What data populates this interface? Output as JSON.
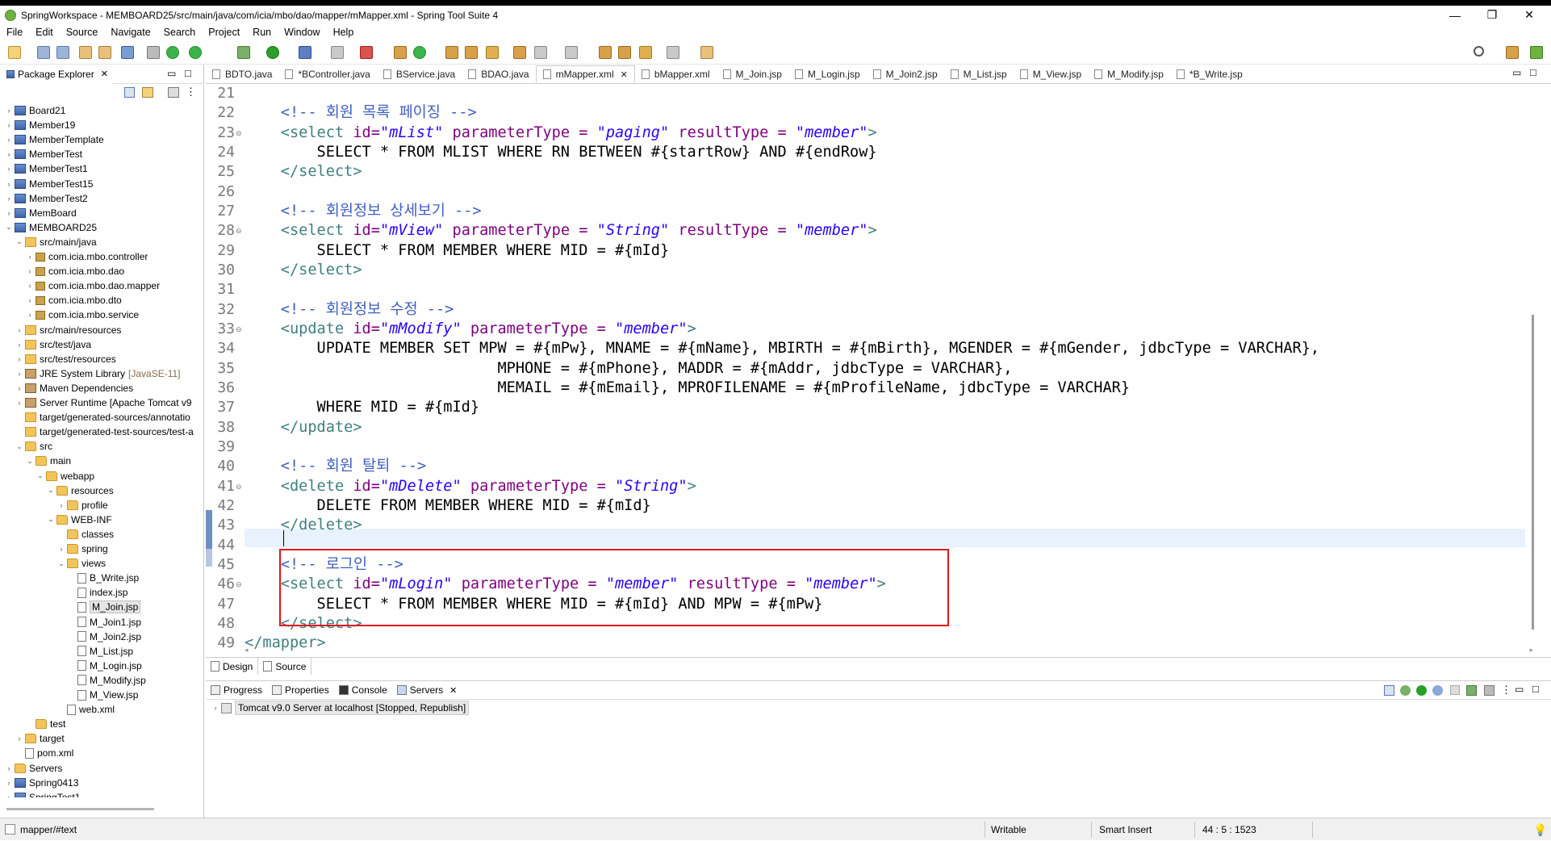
{
  "window": {
    "title": "SpringWorkspace - MEMBOARD25/src/main/java/com/icia/mbo/dao/mapper/mMapper.xml - Spring Tool Suite 4",
    "minimize": "—",
    "maximize": "❐",
    "close": "✕"
  },
  "menu": [
    "File",
    "Edit",
    "Source",
    "Navigate",
    "Search",
    "Project",
    "Run",
    "Window",
    "Help"
  ],
  "package_explorer": {
    "tab_label": "Package Explorer",
    "close": "✕",
    "tree": [
      {
        "label": "Board21",
        "icon": "project-icon",
        "level": 0,
        "twisty": "›"
      },
      {
        "label": "Member19",
        "icon": "project-icon",
        "level": 0,
        "twisty": "›"
      },
      {
        "label": "MemberTemplate",
        "icon": "project-icon",
        "level": 0,
        "twisty": "›"
      },
      {
        "label": "MemberTest",
        "icon": "project-icon",
        "level": 0,
        "twisty": "›"
      },
      {
        "label": "MemberTest1",
        "icon": "project-icon",
        "level": 0,
        "twisty": "›"
      },
      {
        "label": "MemberTest15",
        "icon": "project-icon",
        "level": 0,
        "twisty": "›"
      },
      {
        "label": "MemberTest2",
        "icon": "project-icon",
        "level": 0,
        "twisty": "›"
      },
      {
        "label": "MemBoard",
        "icon": "project-icon",
        "level": 0,
        "twisty": "›"
      },
      {
        "label": "MEMBOARD25",
        "icon": "project-icon",
        "level": 0,
        "twisty": "⌄"
      },
      {
        "label": "src/main/java",
        "icon": "source-folder-icon",
        "level": 1,
        "twisty": "⌄"
      },
      {
        "label": "com.icia.mbo.controller",
        "icon": "package-icon",
        "level": 2,
        "twisty": "›"
      },
      {
        "label": "com.icia.mbo.dao",
        "icon": "package-icon",
        "level": 2,
        "twisty": "›"
      },
      {
        "label": "com.icia.mbo.dao.mapper",
        "icon": "package-icon",
        "level": 2,
        "twisty": "›"
      },
      {
        "label": "com.icia.mbo.dto",
        "icon": "package-icon",
        "level": 2,
        "twisty": "›"
      },
      {
        "label": "com.icia.mbo.service",
        "icon": "package-icon",
        "level": 2,
        "twisty": "›"
      },
      {
        "label": "src/main/resources",
        "icon": "source-folder-icon",
        "level": 1,
        "twisty": "›"
      },
      {
        "label": "src/test/java",
        "icon": "source-folder-icon",
        "level": 1,
        "twisty": "›"
      },
      {
        "label": "src/test/resources",
        "icon": "source-folder-icon",
        "level": 1,
        "twisty": "›"
      },
      {
        "label": "JRE System Library",
        "suffix": "[JavaSE-11]",
        "icon": "library-icon",
        "level": 1,
        "twisty": "›"
      },
      {
        "label": "Maven Dependencies",
        "icon": "library-icon",
        "level": 1,
        "twisty": "›"
      },
      {
        "label": "Server Runtime [Apache Tomcat v9",
        "icon": "library-icon",
        "level": 1,
        "twisty": "›"
      },
      {
        "label": "target/generated-sources/annotatio",
        "icon": "source-folder-icon",
        "level": 1,
        "twisty": ""
      },
      {
        "label": "target/generated-test-sources/test-a",
        "icon": "source-folder-icon",
        "level": 1,
        "twisty": ""
      },
      {
        "label": "src",
        "icon": "folder-icon",
        "level": 1,
        "twisty": "⌄"
      },
      {
        "label": "main",
        "icon": "folder-icon",
        "level": 2,
        "twisty": "⌄"
      },
      {
        "label": "webapp",
        "icon": "folder-icon",
        "level": 3,
        "twisty": "⌄"
      },
      {
        "label": "resources",
        "icon": "folder-icon",
        "level": 4,
        "twisty": "⌄"
      },
      {
        "label": "profile",
        "icon": "folder-icon",
        "level": 5,
        "twisty": "›"
      },
      {
        "label": "WEB-INF",
        "icon": "folder-icon",
        "level": 4,
        "twisty": "⌄"
      },
      {
        "label": "classes",
        "icon": "folder-icon",
        "level": 5,
        "twisty": ""
      },
      {
        "label": "spring",
        "icon": "folder-icon",
        "level": 5,
        "twisty": "›"
      },
      {
        "label": "views",
        "icon": "folder-icon",
        "level": 5,
        "twisty": "⌄"
      },
      {
        "label": "B_Write.jsp",
        "icon": "jsp-file-icon",
        "level": 6,
        "twisty": ""
      },
      {
        "label": "index.jsp",
        "icon": "jsp-file-icon",
        "level": 6,
        "twisty": ""
      },
      {
        "label": "M_Join.jsp",
        "icon": "jsp-file-icon",
        "level": 6,
        "twisty": "",
        "selected": true
      },
      {
        "label": "M_Join1.jsp",
        "icon": "jsp-file-icon",
        "level": 6,
        "twisty": ""
      },
      {
        "label": "M_Join2.jsp",
        "icon": "jsp-file-icon",
        "level": 6,
        "twisty": ""
      },
      {
        "label": "M_List.jsp",
        "icon": "jsp-file-icon",
        "level": 6,
        "twisty": ""
      },
      {
        "label": "M_Login.jsp",
        "icon": "jsp-file-icon",
        "level": 6,
        "twisty": ""
      },
      {
        "label": "M_Modify.jsp",
        "icon": "jsp-file-icon",
        "level": 6,
        "twisty": ""
      },
      {
        "label": "M_View.jsp",
        "icon": "jsp-file-icon",
        "level": 6,
        "twisty": ""
      },
      {
        "label": "web.xml",
        "icon": "xml-file-icon",
        "level": 5,
        "twisty": ""
      },
      {
        "label": "test",
        "icon": "folder-icon",
        "level": 2,
        "twisty": ""
      },
      {
        "label": "target",
        "icon": "folder-icon",
        "level": 1,
        "twisty": "›"
      },
      {
        "label": "pom.xml",
        "icon": "xml-file-icon",
        "level": 1,
        "twisty": ""
      },
      {
        "label": "Servers",
        "icon": "folder-icon",
        "level": 0,
        "twisty": "›"
      },
      {
        "label": "Spring0413",
        "icon": "project-icon",
        "level": 0,
        "twisty": "›"
      },
      {
        "label": "SpringTest1",
        "icon": "project-icon",
        "level": 0,
        "twisty": "›"
      }
    ]
  },
  "editor_tabs": [
    {
      "label": "BDTO.java",
      "active": false
    },
    {
      "label": "*BController.java",
      "active": false
    },
    {
      "label": "BService.java",
      "active": false
    },
    {
      "label": "BDAO.java",
      "active": false
    },
    {
      "label": "mMapper.xml",
      "active": true
    },
    {
      "label": "bMapper.xml",
      "active": false
    },
    {
      "label": "M_Join.jsp",
      "active": false
    },
    {
      "label": "M_Login.jsp",
      "active": false
    },
    {
      "label": "M_Join2.jsp",
      "active": false
    },
    {
      "label": "M_List.jsp",
      "active": false
    },
    {
      "label": "M_View.jsp",
      "active": false
    },
    {
      "label": "M_Modify.jsp",
      "active": false
    },
    {
      "label": "*B_Write.jsp",
      "active": false
    }
  ],
  "active_tab_close": "✕",
  "code_lines": [
    {
      "n": "21",
      "fold": "",
      "segs": []
    },
    {
      "n": "22",
      "fold": "",
      "segs": [
        [
          "    ",
          "tx"
        ],
        [
          "<!-- 회원 목록 페이징 -->",
          "cm"
        ]
      ]
    },
    {
      "n": "23",
      "fold": "⊖",
      "segs": [
        [
          "    ",
          "tx"
        ],
        [
          "<select ",
          "tg"
        ],
        [
          "id=",
          "at"
        ],
        [
          "\"mList\"",
          "vl"
        ],
        [
          " parameterType = ",
          "at"
        ],
        [
          "\"paging\"",
          "vl"
        ],
        [
          " resultType = ",
          "at"
        ],
        [
          "\"member\"",
          "vl"
        ],
        [
          ">",
          "tg"
        ]
      ]
    },
    {
      "n": "24",
      "fold": "",
      "segs": [
        [
          "        SELECT * FROM MLIST WHERE RN BETWEEN #{startRow} AND #{endRow}",
          "tx"
        ]
      ]
    },
    {
      "n": "25",
      "fold": "",
      "segs": [
        [
          "    ",
          "tx"
        ],
        [
          "</select>",
          "tg"
        ]
      ]
    },
    {
      "n": "26",
      "fold": "",
      "segs": []
    },
    {
      "n": "27",
      "fold": "",
      "segs": [
        [
          "    ",
          "tx"
        ],
        [
          "<!-- 회원정보 상세보기 -->",
          "cm"
        ]
      ]
    },
    {
      "n": "28",
      "fold": "⊖",
      "segs": [
        [
          "    ",
          "tx"
        ],
        [
          "<select ",
          "tg"
        ],
        [
          "id=",
          "at"
        ],
        [
          "\"mView\"",
          "vl"
        ],
        [
          " parameterType = ",
          "at"
        ],
        [
          "\"String\"",
          "vl"
        ],
        [
          " resultType = ",
          "at"
        ],
        [
          "\"member\"",
          "vl"
        ],
        [
          ">",
          "tg"
        ]
      ]
    },
    {
      "n": "29",
      "fold": "",
      "segs": [
        [
          "        SELECT * FROM MEMBER WHERE MID = #{mId}",
          "tx"
        ]
      ]
    },
    {
      "n": "30",
      "fold": "",
      "segs": [
        [
          "    ",
          "tx"
        ],
        [
          "</select>",
          "tg"
        ]
      ]
    },
    {
      "n": "31",
      "fold": "",
      "segs": []
    },
    {
      "n": "32",
      "fold": "",
      "segs": [
        [
          "    ",
          "tx"
        ],
        [
          "<!-- 회원정보 수정 -->",
          "cm"
        ]
      ]
    },
    {
      "n": "33",
      "fold": "⊖",
      "segs": [
        [
          "    ",
          "tx"
        ],
        [
          "<update ",
          "tg"
        ],
        [
          "id=",
          "at"
        ],
        [
          "\"mModify\"",
          "vl"
        ],
        [
          " parameterType = ",
          "at"
        ],
        [
          "\"member\"",
          "vl"
        ],
        [
          ">",
          "tg"
        ]
      ]
    },
    {
      "n": "34",
      "fold": "",
      "segs": [
        [
          "        UPDATE MEMBER SET MPW = #{mPw}, MNAME = #{mName}, MBIRTH = #{mBirth}, MGENDER = #{mGender, jdbcType = VARCHAR},",
          "tx"
        ]
      ]
    },
    {
      "n": "35",
      "fold": "",
      "segs": [
        [
          "                            MPHONE = #{mPhone}, MADDR = #{mAddr, jdbcType = VARCHAR},",
          "tx"
        ]
      ]
    },
    {
      "n": "36",
      "fold": "",
      "segs": [
        [
          "                            MEMAIL = #{mEmail}, MPROFILENAME = #{mProfileName, jdbcType = VARCHAR}",
          "tx"
        ]
      ]
    },
    {
      "n": "37",
      "fold": "",
      "segs": [
        [
          "        WHERE MID = #{mId}",
          "tx"
        ]
      ]
    },
    {
      "n": "38",
      "fold": "",
      "segs": [
        [
          "    ",
          "tx"
        ],
        [
          "</update>",
          "tg"
        ]
      ]
    },
    {
      "n": "39",
      "fold": "",
      "segs": []
    },
    {
      "n": "40",
      "fold": "",
      "segs": [
        [
          "    ",
          "tx"
        ],
        [
          "<!-- 회원 탈퇴 -->",
          "cm"
        ]
      ]
    },
    {
      "n": "41",
      "fold": "⊖",
      "segs": [
        [
          "    ",
          "tx"
        ],
        [
          "<delete ",
          "tg"
        ],
        [
          "id=",
          "at"
        ],
        [
          "\"mDelete\"",
          "vl"
        ],
        [
          " parameterType = ",
          "at"
        ],
        [
          "\"String\"",
          "vl"
        ],
        [
          ">",
          "tg"
        ]
      ]
    },
    {
      "n": "42",
      "fold": "",
      "segs": [
        [
          "        DELETE FROM MEMBER WHERE MID = #{mId}",
          "tx"
        ]
      ]
    },
    {
      "n": "43",
      "fold": "",
      "segs": [
        [
          "    ",
          "tx"
        ],
        [
          "</delete>",
          "tg"
        ]
      ]
    },
    {
      "n": "44",
      "fold": "",
      "segs": []
    },
    {
      "n": "45",
      "fold": "",
      "segs": [
        [
          "    ",
          "tx"
        ],
        [
          "<!-- 로그인 -->",
          "cm"
        ]
      ]
    },
    {
      "n": "46",
      "fold": "⊖",
      "segs": [
        [
          "    ",
          "tx"
        ],
        [
          "<select ",
          "tg"
        ],
        [
          "id=",
          "at"
        ],
        [
          "\"mLogin\"",
          "vl"
        ],
        [
          " parameterType = ",
          "at"
        ],
        [
          "\"member\"",
          "vl"
        ],
        [
          " resultType = ",
          "at"
        ],
        [
          "\"member\"",
          "vl"
        ],
        [
          ">",
          "tg"
        ]
      ]
    },
    {
      "n": "47",
      "fold": "",
      "segs": [
        [
          "        SELECT * FROM MEMBER WHERE MID = #{mId} AND MPW = #{mPw}",
          "tx"
        ]
      ]
    },
    {
      "n": "48",
      "fold": "",
      "segs": [
        [
          "    ",
          "tx"
        ],
        [
          "</select>",
          "tg"
        ]
      ]
    },
    {
      "n": "49",
      "fold": "",
      "segs": [
        [
          "</mapper>",
          "tg"
        ]
      ]
    }
  ],
  "mode_tabs": {
    "design": "Design",
    "source": "Source"
  },
  "bottom_tabs": {
    "progress": "Progress",
    "properties": "Properties",
    "console": "Console",
    "servers": "Servers",
    "close": "✕"
  },
  "servers": {
    "entry": "Tomcat v9.0 Server at localhost  [Stopped, Republish]"
  },
  "status": {
    "path": "mapper/#text",
    "writable": "Writable",
    "insert_mode": "Smart Insert",
    "position": "44 : 5 : 1523"
  },
  "colors": {
    "comment": "#3f5fbf",
    "tag": "#3f7f7f",
    "attribute": "#7f007f",
    "value": "#2a00ff",
    "highlight_box": "#e0161e",
    "current_line": "#e8f2fe"
  }
}
